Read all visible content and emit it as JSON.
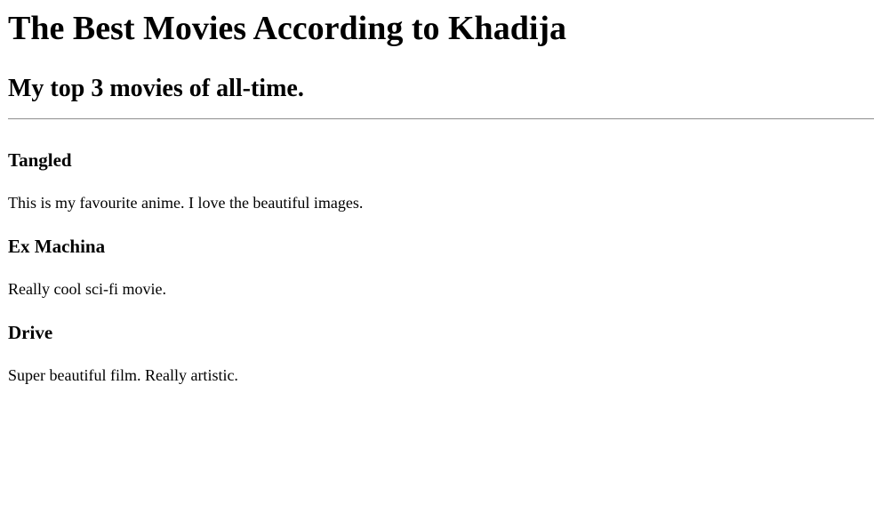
{
  "page": {
    "title": "The Best Movies According to Khadija",
    "subtitle": "My top 3 movies of all-time."
  },
  "movies": [
    {
      "title": "Tangled",
      "description": "This is my favourite anime. I love the beautiful images."
    },
    {
      "title": "Ex Machina",
      "description": "Really cool sci-fi movie."
    },
    {
      "title": "Drive",
      "description": "Super beautiful film. Really artistic."
    }
  ]
}
